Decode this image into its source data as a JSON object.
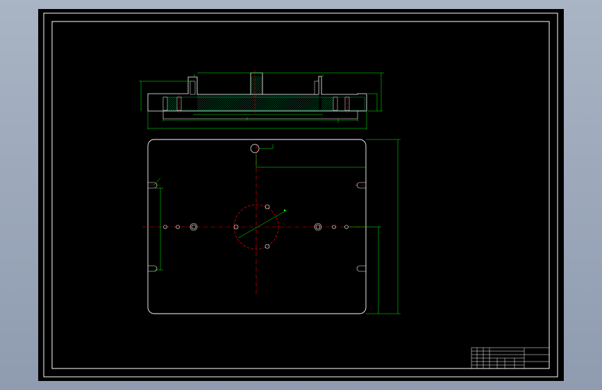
{
  "notes": {
    "title": "",
    "lines": [
      "",
      "",
      "",
      ""
    ]
  },
  "colors": {
    "background": "#000000",
    "frame": "#ffffff",
    "outline": "#ffffff",
    "dimension": "#00ff00",
    "centerline": "#ff0000",
    "hatch": "#00cc66",
    "chrome": "#a0acbd"
  }
}
